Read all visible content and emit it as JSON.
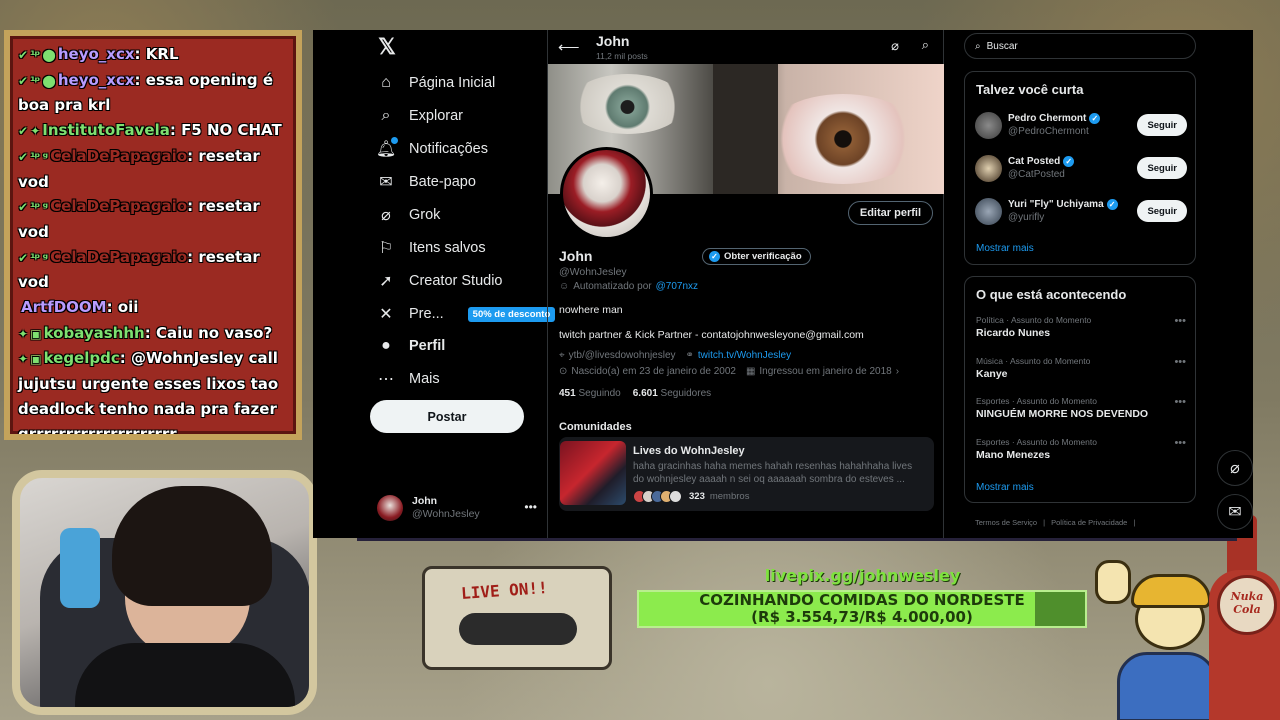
{
  "chat": [
    {
      "user": "heyo_xcx",
      "user_color": "#b89cff",
      "badges": "✔ ¹ᵖ ⬤",
      "message": "KRL"
    },
    {
      "user": "heyo_xcx",
      "user_color": "#b89cff",
      "badges": "✔ ¹ᵖ ⬤",
      "message": "essa opening é boa pra krl"
    },
    {
      "user": "InstitutoFavela",
      "user_color": "#7ee070",
      "badges": "✔ ✦",
      "message": "F5 NO CHAT"
    },
    {
      "user": "CelaDePapagaio",
      "user_color": "#9b2a22",
      "badges": "✔ ¹ᵖ ᵍ",
      "message": "resetar vod"
    },
    {
      "user": "CelaDePapagaio",
      "user_color": "#9b2a22",
      "badges": "✔ ¹ᵖ ᵍ",
      "message": "resetar vod"
    },
    {
      "user": "CelaDePapagaio",
      "user_color": "#9b2a22",
      "badges": "✔ ¹ᵖ ᵍ",
      "message": "resetar vod"
    },
    {
      "user": "ArtfDOOM",
      "user_color": "#b89cff",
      "badges": "",
      "message": "oii"
    },
    {
      "user": "kobayashhh",
      "user_color": "#7ee070",
      "badges": "✦ ▣",
      "message": "Caiu no vaso?"
    },
    {
      "user": "kegelpdc",
      "user_color": "#7ee070",
      "badges": "✦ ▣",
      "message": "@WohnJesley call jujutsu urgente esses lixos tao deadlock tenho nada pra fazer grrrrrrrrrrrrrrrrrrrr"
    }
  ],
  "overlay": {
    "cassette_label": "LIVE ON!!",
    "livepix_url": "livepix.gg/johnwesley",
    "goal_title": "COZINHANDO COMIDAS DO NORDESTE",
    "goal_amount": "(R$ 3.554,73/R$ 4.000,00)",
    "goal_progress": 0.8887,
    "nuka_text": "Nuka\nCola"
  },
  "nav": {
    "items": [
      {
        "key": "home",
        "icon": "home-icon",
        "glyph": "⌂",
        "label": "Página Inicial"
      },
      {
        "key": "explore",
        "icon": "search-icon",
        "glyph": "⌕",
        "label": "Explorar"
      },
      {
        "key": "notifications",
        "icon": "bell-icon",
        "glyph": "🔔︎",
        "label": "Notificações"
      },
      {
        "key": "messages",
        "icon": "mail-icon",
        "glyph": "✉",
        "label": "Bate-papo"
      },
      {
        "key": "grok",
        "icon": "grok-icon",
        "glyph": "⌀",
        "label": "Grok"
      },
      {
        "key": "bookmarks",
        "icon": "bookmark-icon",
        "glyph": "⚐",
        "label": "Itens salvos"
      },
      {
        "key": "creator-studio",
        "icon": "rocket-icon",
        "glyph": "➚",
        "label": "Creator Studio"
      },
      {
        "key": "premium",
        "icon": "x-logo-icon",
        "glyph": "✕",
        "label": "Pre...",
        "badge": "50% de desconto"
      },
      {
        "key": "profile",
        "icon": "person-icon",
        "glyph": "●",
        "label": "Perfil"
      },
      {
        "key": "more",
        "icon": "more-circle-icon",
        "glyph": "⋯",
        "label": "Mais"
      }
    ],
    "post_label": "Postar",
    "account": {
      "name": "John",
      "handle": "@WohnJesley"
    }
  },
  "profile": {
    "header_name": "John",
    "header_posts": "11,2 mil posts",
    "edit_label": "Editar perfil",
    "display_name": "John",
    "verify_label": "Obter verificação",
    "handle": "@WohnJesley",
    "automated_prefix": "Automatizado por",
    "automated_by": "@707nxz",
    "bio_line1": "nowhere man",
    "bio_line2": "twitch partner & Kick Partner - contatojohnwesleyone@gmail.com",
    "ytb": "ytb/@livesdowohnjesley",
    "website": "twitch.tv/WohnJesley",
    "born": "Nascido(a) em 23 de janeiro de 2002",
    "joined": "Ingressou em janeiro de 2018",
    "following_count": "451",
    "following_label": "Seguindo",
    "followers_count": "6.601",
    "followers_label": "Seguidores"
  },
  "communities": {
    "title": "Comunidades",
    "card": {
      "name": "Lives do WohnJesley",
      "description": "haha gracinhas haha memes hahah resenhas hahahhaha lives do wohnjesley aaaah n sei oq aaaaaah sombra do esteves ...",
      "members_count": "323",
      "members_label": "membros"
    }
  },
  "sidebar": {
    "search_placeholder": "Buscar",
    "suggest_title": "Talvez você curta",
    "suggestions": [
      {
        "name": "Pedro Chermont",
        "handle": "@PedroChermont",
        "follow": "Seguir"
      },
      {
        "name": "Cat Posted",
        "handle": "@CatPosted",
        "follow": "Seguir"
      },
      {
        "name": "Yuri \"Fly\" Uchiyama",
        "handle": "@yurifly",
        "follow": "Seguir"
      }
    ],
    "show_more": "Mostrar mais",
    "trends_title": "O que está acontecendo",
    "trends": [
      {
        "category": "Política · Assunto do Momento",
        "name": "Ricardo Nunes"
      },
      {
        "category": "Música · Assunto do Momento",
        "name": "Kanye"
      },
      {
        "category": "Esportes · Assunto do Momento",
        "name": "NINGUÉM MORRE NOS DEVENDO"
      },
      {
        "category": "Esportes · Assunto do Momento",
        "name": "Mano Menezes"
      }
    ],
    "trends_show_more": "Mostrar mais",
    "footer": [
      "Termos de Serviço",
      "|",
      "Política de Privacidade",
      "|"
    ]
  },
  "colors": {
    "accent": "#1d9bf0",
    "background": "#000000",
    "chat_panel": "#9b2a22",
    "goal_bar": "#8ceb4d"
  }
}
